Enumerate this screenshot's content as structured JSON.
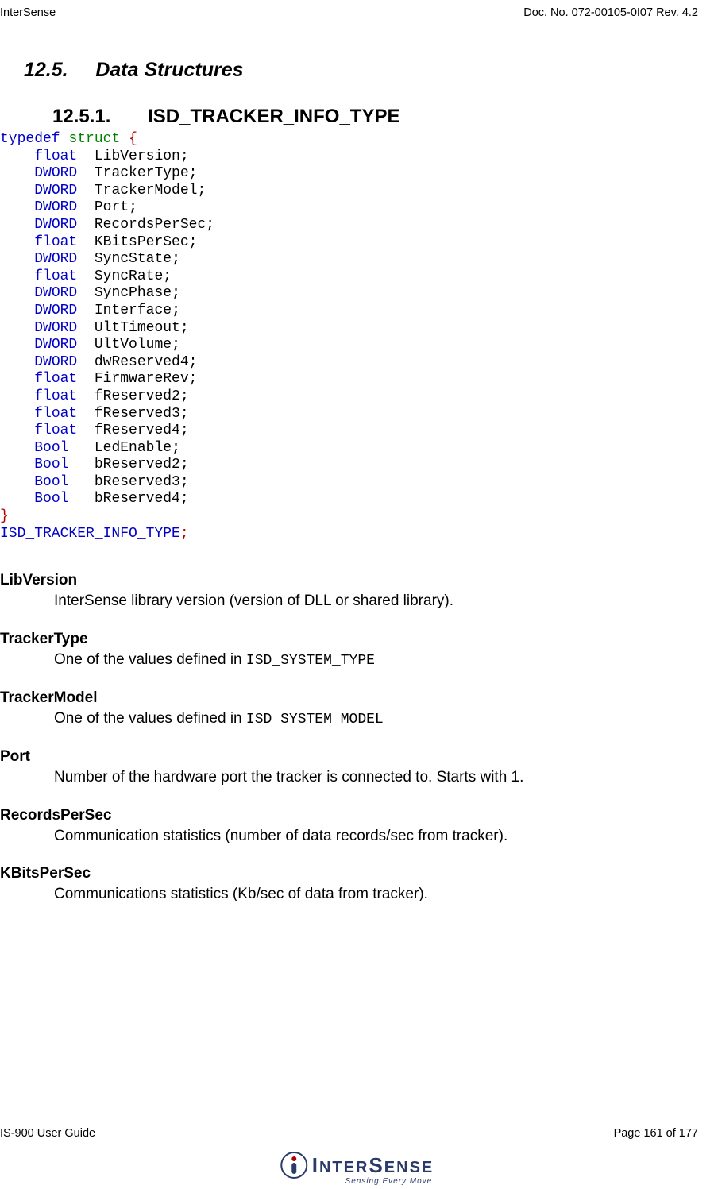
{
  "header": {
    "left": "InterSense",
    "right": "Doc. No. 072-00105-0I07 Rev. 4.2"
  },
  "section": {
    "number": "12.5.",
    "title": "Data Structures"
  },
  "subsection": {
    "number": "12.5.1.",
    "title": "ISD_TRACKER_INFO_TYPE"
  },
  "code": {
    "typedef": "typedef",
    "struct": "struct",
    "open": "{",
    "fields": [
      {
        "type": "float",
        "name": "LibVersion"
      },
      {
        "type": "DWORD",
        "name": "TrackerType"
      },
      {
        "type": "DWORD",
        "name": "TrackerModel"
      },
      {
        "type": "DWORD",
        "name": "Port"
      },
      {
        "type": "DWORD",
        "name": "RecordsPerSec"
      },
      {
        "type": "float",
        "name": "KBitsPerSec"
      },
      {
        "type": "DWORD",
        "name": "SyncState"
      },
      {
        "type": "float",
        "name": "SyncRate"
      },
      {
        "type": "DWORD",
        "name": "SyncPhase"
      },
      {
        "type": "DWORD",
        "name": "Interface"
      },
      {
        "type": "DWORD",
        "name": "UltTimeout"
      },
      {
        "type": "DWORD",
        "name": "UltVolume"
      },
      {
        "type": "DWORD",
        "name": "dwReserved4"
      },
      {
        "type": "float",
        "name": "FirmwareRev"
      },
      {
        "type": "float",
        "name": "fReserved2"
      },
      {
        "type": "float",
        "name": "fReserved3"
      },
      {
        "type": "float",
        "name": "fReserved4"
      },
      {
        "type": "Bool",
        "name": "LedEnable"
      },
      {
        "type": "Bool",
        "name": "bReserved2"
      },
      {
        "type": "Bool",
        "name": "bReserved3"
      },
      {
        "type": "Bool",
        "name": "bReserved4"
      }
    ],
    "close": "}",
    "typename": "ISD_TRACKER_INFO_TYPE",
    "semi": ";"
  },
  "descriptions": {
    "lib_version": {
      "term": "LibVersion",
      "text": "InterSense library version (version of DLL or shared library)."
    },
    "tracker_type": {
      "term": "TrackerType",
      "prefix": "One of the values defined in ",
      "mono": "ISD_SYSTEM_TYPE"
    },
    "tracker_model": {
      "term": "TrackerModel",
      "prefix": "One of the values defined in ",
      "mono": "ISD_SYSTEM_MODEL"
    },
    "port": {
      "term": "Port",
      "text": "Number of the hardware port the tracker is connected to.  Starts with 1."
    },
    "records_per_sec": {
      "term": "RecordsPerSec",
      "text": "Communication statistics (number of data records/sec from tracker)."
    },
    "kbits_per_sec": {
      "term": "KBitsPerSec",
      "text": "Communications statistics (Kb/sec of data from tracker)."
    }
  },
  "footer": {
    "left": "IS-900 User Guide",
    "right": "Page 161 of 177"
  },
  "logo": {
    "text_i": "I",
    "text_nter": "NTER",
    "text_s": "S",
    "text_ense": "ENSE",
    "tagline": "Sensing Every Move"
  }
}
